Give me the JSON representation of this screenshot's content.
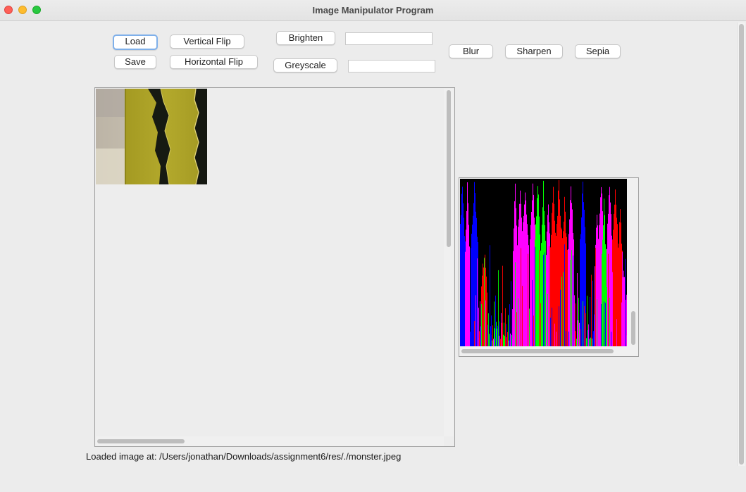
{
  "window": {
    "title": "Image Manipulator Program"
  },
  "toolbar": {
    "load_label": "Load",
    "save_label": "Save",
    "vertical_flip_label": "Vertical Flip",
    "horizontal_flip_label": "Horizontal Flip",
    "brighten_label": "Brighten",
    "greyscale_label": "Greyscale",
    "brighten_value": "",
    "greyscale_value": "",
    "blur_label": "Blur",
    "sharpen_label": "Sharpen",
    "sepia_label": "Sepia"
  },
  "status": {
    "text": "Loaded image at:  /Users/jonathan/Downloads/assignment6/res/./monster.jpeg"
  },
  "colors": {
    "histogram_red": "#ff0000",
    "histogram_green": "#00ff00",
    "histogram_blue": "#0000ff",
    "histogram_overlap": "#ff00ff",
    "histogram_background": "#000000"
  }
}
